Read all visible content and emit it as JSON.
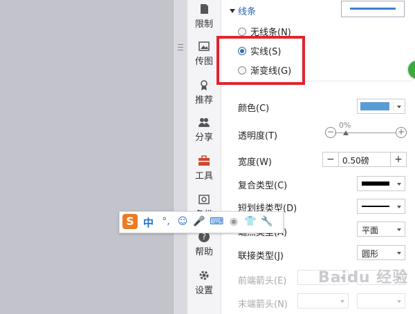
{
  "tabs": [
    {
      "label": "限制",
      "icon": "restrict-icon"
    },
    {
      "label": "传图",
      "icon": "upload-image-icon"
    },
    {
      "label": "推荐",
      "icon": "recommend-icon"
    },
    {
      "label": "分享",
      "icon": "share-icon"
    },
    {
      "label": "工具",
      "icon": "toolbox-icon"
    },
    {
      "label": "备份",
      "icon": "backup-icon"
    },
    {
      "label": "帮助",
      "icon": "help-icon"
    },
    {
      "label": "设置",
      "icon": "settings-icon"
    }
  ],
  "line_section": {
    "title": "线条",
    "options": [
      {
        "label": "无线条(N)",
        "selected": false
      },
      {
        "label": "实线(S)",
        "selected": true
      },
      {
        "label": "渐变线(G)",
        "selected": false
      }
    ]
  },
  "props": {
    "color": {
      "label": "颜色(C)",
      "value_color": "#5b9bd5"
    },
    "transparency": {
      "label": "透明度(T)",
      "value": "0%"
    },
    "width": {
      "label": "宽度(W)",
      "value": "0.50磅",
      "minus": "−",
      "plus": "+"
    },
    "compound": {
      "label": "复合类型(C)"
    },
    "dash": {
      "label": "短划线类型(D)"
    },
    "cap": {
      "label": "端点类型(A)",
      "value": "平面"
    },
    "join": {
      "label": "联接类型(J)",
      "value": "圆形"
    },
    "begin_arrow": {
      "label": "前端箭头(E)"
    },
    "end_arrow": {
      "label": "末端箭头(N)"
    }
  },
  "ime": {
    "logo": "S",
    "mode": "中",
    "punct": "°,",
    "emoji": "☺",
    "mic": "🎤",
    "keyboard": "⌨",
    "shirt": "👕",
    "wrench": "🔧"
  },
  "watermark": "Baidu 经验",
  "colors": {
    "accent": "#2a62b5",
    "highlight_box": "#e0242b",
    "line_preview": "#3d7fd6"
  }
}
